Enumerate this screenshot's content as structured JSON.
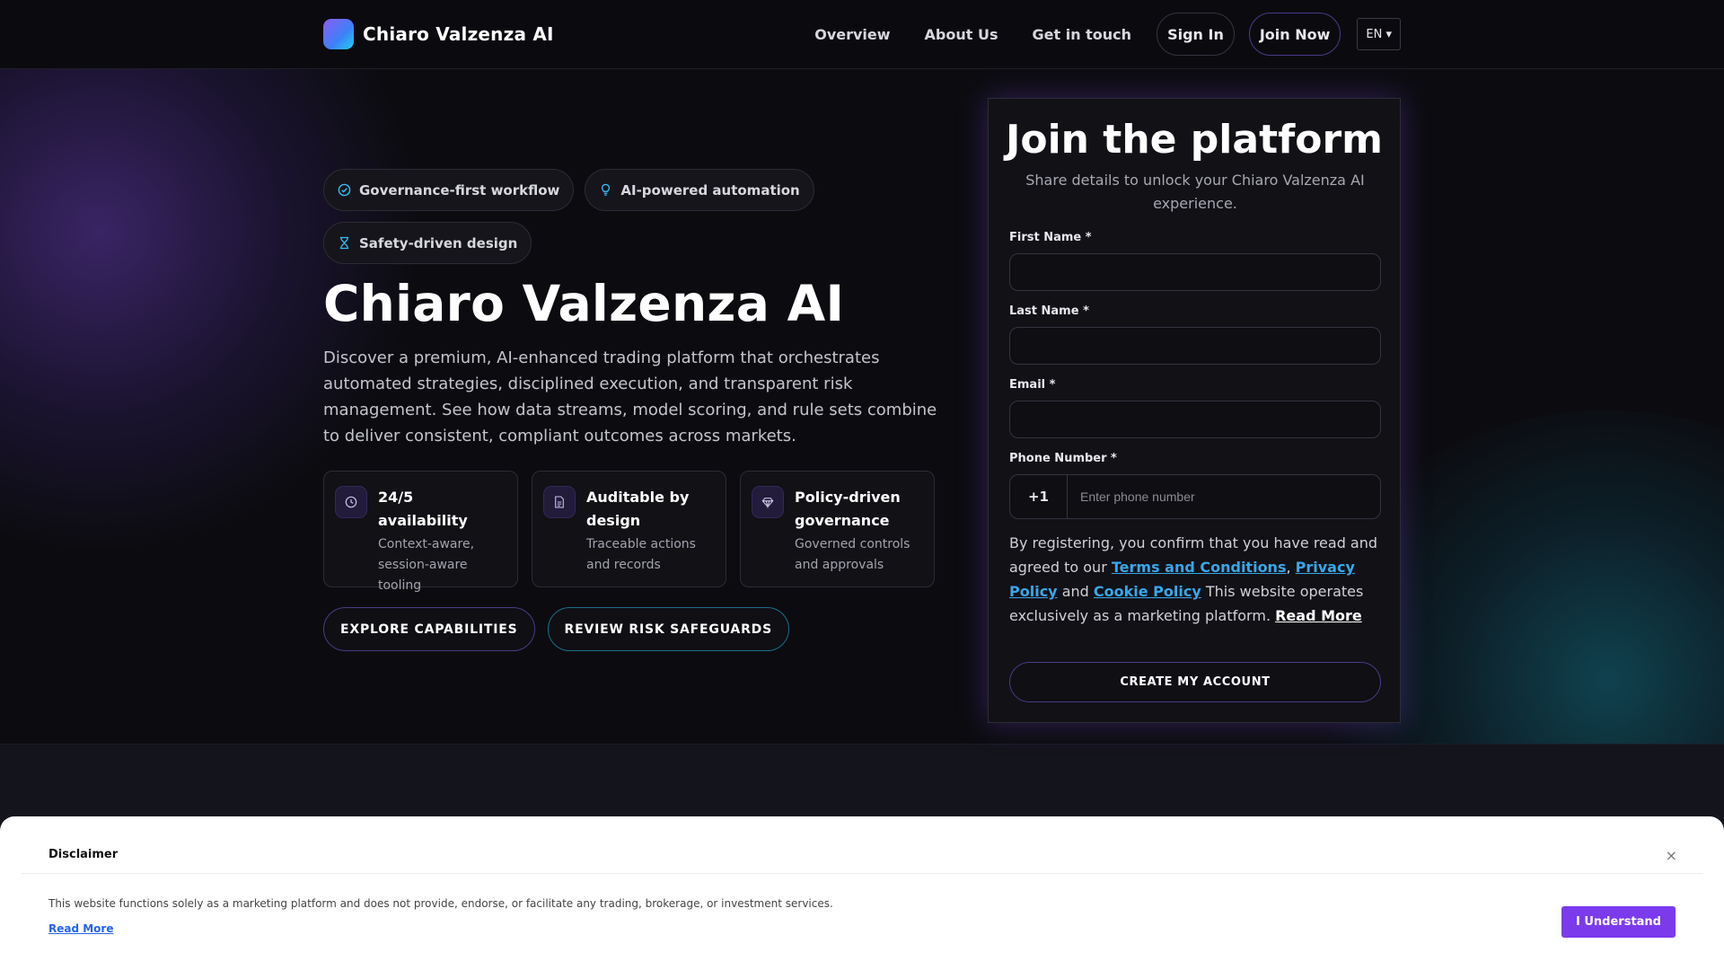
{
  "header": {
    "brand": "Chiaro Valzenza AI",
    "nav": {
      "overview": "Overview",
      "about": "About Us",
      "contact": "Get in touch",
      "signin": "Sign In",
      "join": "Join Now",
      "lang": "EN ▾"
    }
  },
  "hero": {
    "badges": [
      {
        "label": "Governance-first workflow",
        "icon": "check-circle-icon"
      },
      {
        "label": "AI-powered automation",
        "icon": "lightbulb-icon"
      },
      {
        "label": "Safety-driven design",
        "icon": "hourglass-icon"
      }
    ],
    "title": "Chiaro Valzenza AI",
    "description": "Discover a premium, AI-enhanced trading platform that orchestrates automated strategies, disciplined execution, and transparent risk management. See how data streams, model scoring, and rule sets combine to deliver consistent, compliant outcomes across markets.",
    "features": [
      {
        "title": "24/5 availability",
        "subtitle": "Context-aware, session-aware tooling",
        "icon": "clock-icon"
      },
      {
        "title": "Auditable by design",
        "subtitle": "Traceable actions and records",
        "icon": "document-icon"
      },
      {
        "title": "Policy-driven governance",
        "subtitle": "Governed controls and approvals",
        "icon": "gem-icon"
      }
    ],
    "cta_primary": "EXPLORE CAPABILITIES",
    "cta_secondary": "REVIEW RISK SAFEGUARDS"
  },
  "form": {
    "title": "Join the platform",
    "subtitle": "Share details to unlock your Chiaro Valzenza AI experience.",
    "first_name_label": "First Name *",
    "last_name_label": "Last Name *",
    "email_label": "Email *",
    "phone_label": "Phone Number *",
    "phone_code": "+1",
    "phone_placeholder": "Enter phone number",
    "consent": {
      "prefix": "By registering, you confirm that you have read and agreed to our ",
      "terms": "Terms and Conditions",
      "comma": ", ",
      "privacy": "Privacy Policy",
      "and": " and ",
      "cookie": "Cookie Policy",
      "suffix": " This website operates exclusively as a marketing platform. ",
      "read_more": "Read More"
    },
    "submit": "CREATE MY ACCOUNT"
  },
  "disclaimer": {
    "title": "Disclaimer",
    "close": "×",
    "text": "This website functions solely as a marketing platform and does not provide, endorse, or facilitate any trading, brokerage, or investment services.",
    "read_more": "Read More",
    "button": "I Understand"
  },
  "colors": {
    "accent": "#7c3aed",
    "link": "#38a7e8",
    "background": "#0b0b0f"
  }
}
